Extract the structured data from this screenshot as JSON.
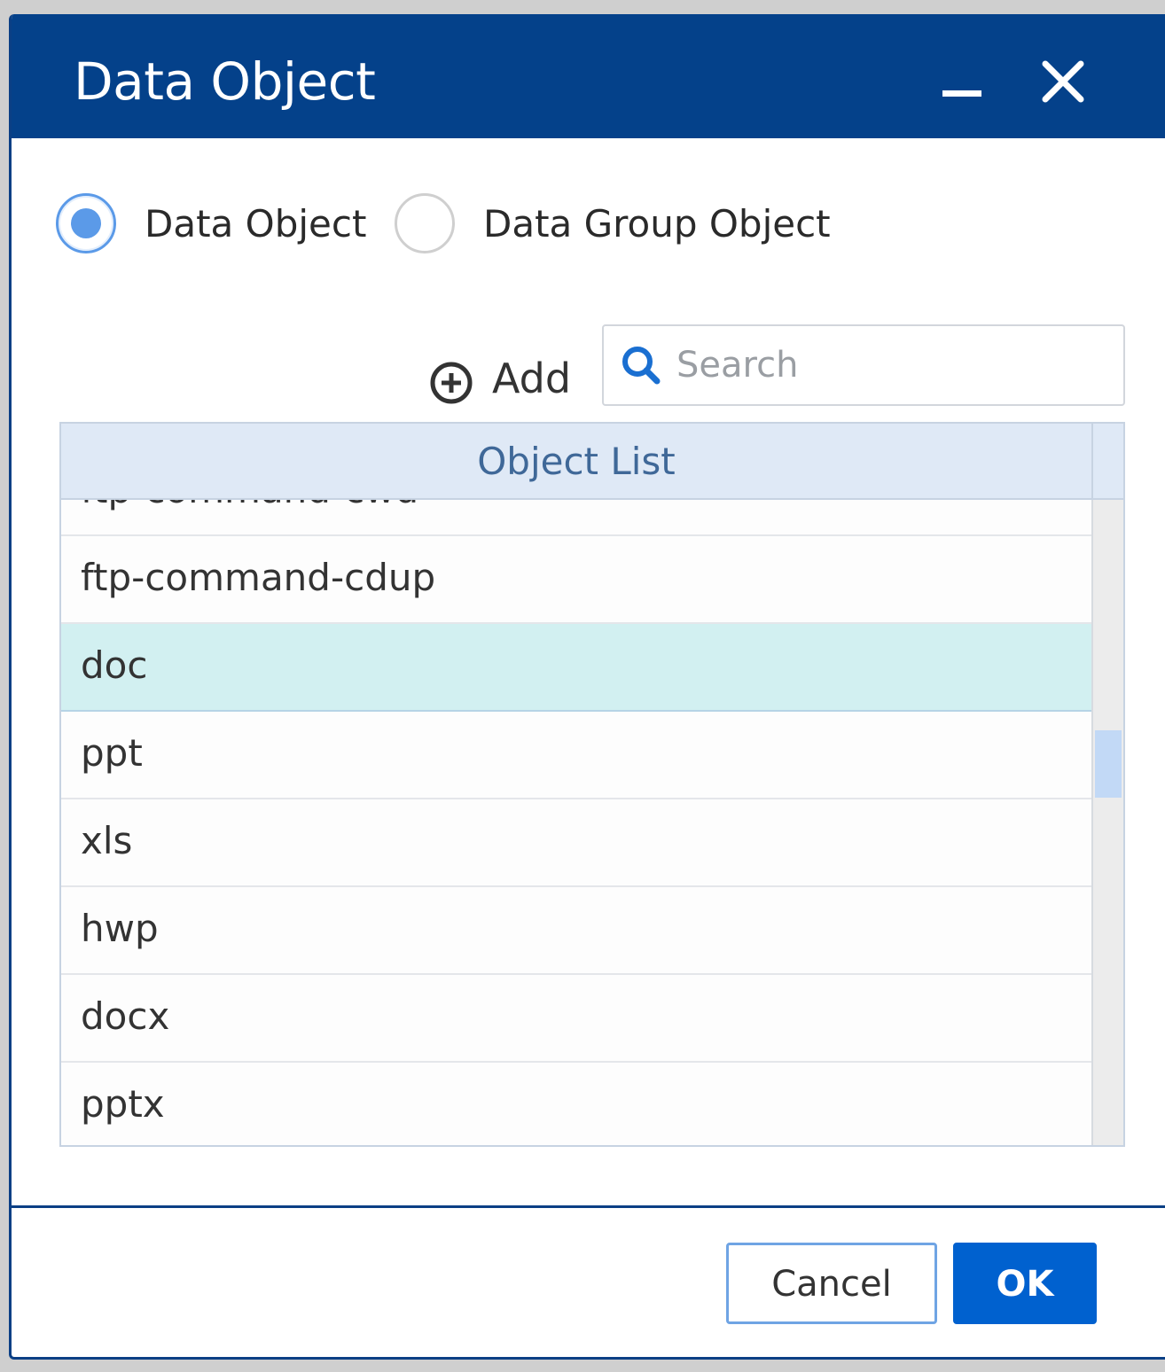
{
  "dialog": {
    "title": "Data Object",
    "header_color": "#04418a"
  },
  "radio_options": [
    {
      "label": "Data Object",
      "checked": true
    },
    {
      "label": "Data Group Object",
      "checked": false
    }
  ],
  "toolbar": {
    "add_label": "Add",
    "search_placeholder": "Search",
    "search_value": ""
  },
  "list": {
    "header": "Object List",
    "items": [
      {
        "label": "ftp-command-cwd",
        "selected": false
      },
      {
        "label": "ftp-command-cdup",
        "selected": false
      },
      {
        "label": "doc",
        "selected": true
      },
      {
        "label": "ppt",
        "selected": false
      },
      {
        "label": "xls",
        "selected": false
      },
      {
        "label": "hwp",
        "selected": false
      },
      {
        "label": "docx",
        "selected": false
      },
      {
        "label": "pptx",
        "selected": false
      }
    ]
  },
  "buttons": {
    "cancel": "Cancel",
    "ok": "OK"
  },
  "colors": {
    "accent": "#0061cf",
    "selected_row": "#d2f0f1",
    "radio_checked": "#5b9ae8"
  }
}
